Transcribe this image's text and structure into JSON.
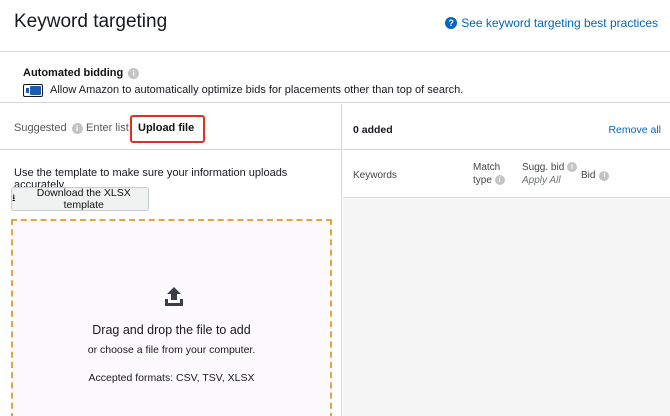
{
  "header": {
    "title": "Keyword targeting",
    "help_link": "See keyword targeting best practices"
  },
  "bidding": {
    "title": "Automated bidding",
    "description": "Allow Amazon to automatically optimize bids for placements other than top of search.",
    "toggle_on": true
  },
  "tabs": [
    {
      "label": "Suggested",
      "active": false
    },
    {
      "label": "Enter list",
      "active": false
    },
    {
      "label": "Upload file",
      "active": true
    }
  ],
  "upload": {
    "instruction": "Use the template to make sure your information uploads accurately.",
    "download_label": "Download the XLSX template",
    "drop_main": "Drag and drop the file to add",
    "drop_sub": "or choose a file from your computer.",
    "formats": "Accepted formats: CSV, TSV, XLSX"
  },
  "added": {
    "count_label": "0 added",
    "remove_all": "Remove all",
    "columns": {
      "keywords": "Keywords",
      "match_line1": "Match",
      "match_line2": "type",
      "sugg_line1": "Sugg. bid",
      "sugg_line2": "Apply All",
      "bid": "Bid"
    }
  },
  "colors": {
    "link": "#0066c0",
    "highlight": "#e3301e",
    "dropzone_border": "#e8a33c",
    "toggle": "#1a5fb4"
  }
}
